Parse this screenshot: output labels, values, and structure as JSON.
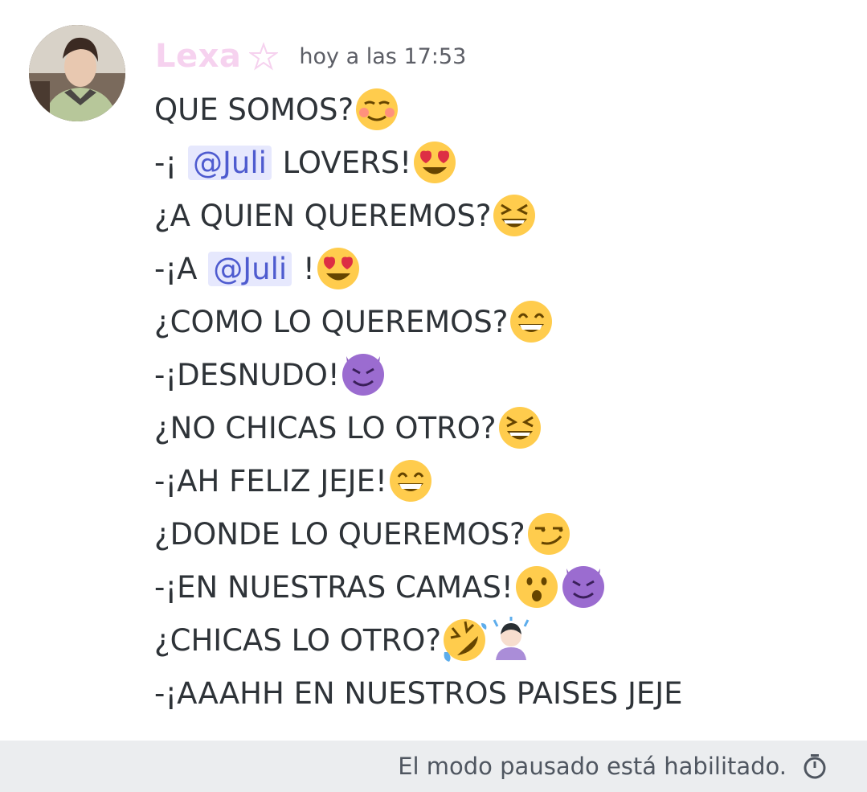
{
  "message": {
    "author": "Lexa",
    "timestamp": "hoy a las 17:53",
    "lines": [
      {
        "parts": [
          {
            "t": "text",
            "v": "QUE SOMOS?"
          },
          {
            "t": "emoji",
            "name": "smiling-face-icon"
          }
        ]
      },
      {
        "parts": [
          {
            "t": "text",
            "v": "-¡ "
          },
          {
            "t": "mention",
            "v": "@Juli"
          },
          {
            "t": "text",
            "v": " LOVERS!"
          },
          {
            "t": "emoji",
            "name": "heart-eyes-icon"
          }
        ]
      },
      {
        "parts": [
          {
            "t": "text",
            "v": "¿A QUIEN QUEREMOS?"
          },
          {
            "t": "emoji",
            "name": "laughing-face-icon"
          }
        ]
      },
      {
        "parts": [
          {
            "t": "text",
            "v": "-¡A "
          },
          {
            "t": "mention",
            "v": "@Juli"
          },
          {
            "t": "text",
            "v": " !"
          },
          {
            "t": "emoji",
            "name": "heart-eyes-icon"
          }
        ]
      },
      {
        "parts": [
          {
            "t": "text",
            "v": "¿COMO LO QUEREMOS?"
          },
          {
            "t": "emoji",
            "name": "grinning-face-icon"
          }
        ]
      },
      {
        "parts": [
          {
            "t": "text",
            "v": "-¡DESNUDO!"
          },
          {
            "t": "emoji",
            "name": "smiling-imp-icon"
          }
        ]
      },
      {
        "parts": [
          {
            "t": "text",
            "v": "¿NO CHICAS LO OTRO?"
          },
          {
            "t": "emoji",
            "name": "laughing-face-icon"
          }
        ]
      },
      {
        "parts": [
          {
            "t": "text",
            "v": "-¡AH FELIZ JEJE!"
          },
          {
            "t": "emoji",
            "name": "beaming-face-icon"
          }
        ]
      },
      {
        "parts": [
          {
            "t": "text",
            "v": "¿DONDE LO QUEREMOS?"
          },
          {
            "t": "emoji",
            "name": "smirking-face-icon"
          }
        ]
      },
      {
        "parts": [
          {
            "t": "text",
            "v": "-¡EN NUESTRAS CAMAS!"
          },
          {
            "t": "emoji",
            "name": "hushed-face-icon"
          },
          {
            "t": "emoji",
            "name": "smiling-imp-icon"
          }
        ]
      },
      {
        "parts": [
          {
            "t": "text",
            "v": "¿CHICAS LO OTRO?"
          },
          {
            "t": "emoji",
            "name": "rolling-laughing-icon"
          },
          {
            "t": "emoji",
            "name": "person-bowing-icon"
          }
        ]
      },
      {
        "parts": [
          {
            "t": "text",
            "v": "-¡AAAHH EN NUESTROS PAISES JEJE"
          }
        ]
      }
    ]
  },
  "footer": {
    "slowmode_text": "El modo pausado está habilitado."
  },
  "colors": {
    "username": "#f6d2ef",
    "mention_bg": "#e6e8fd",
    "mention_text": "#4e5bcf",
    "footer_bg": "#ebedef"
  }
}
